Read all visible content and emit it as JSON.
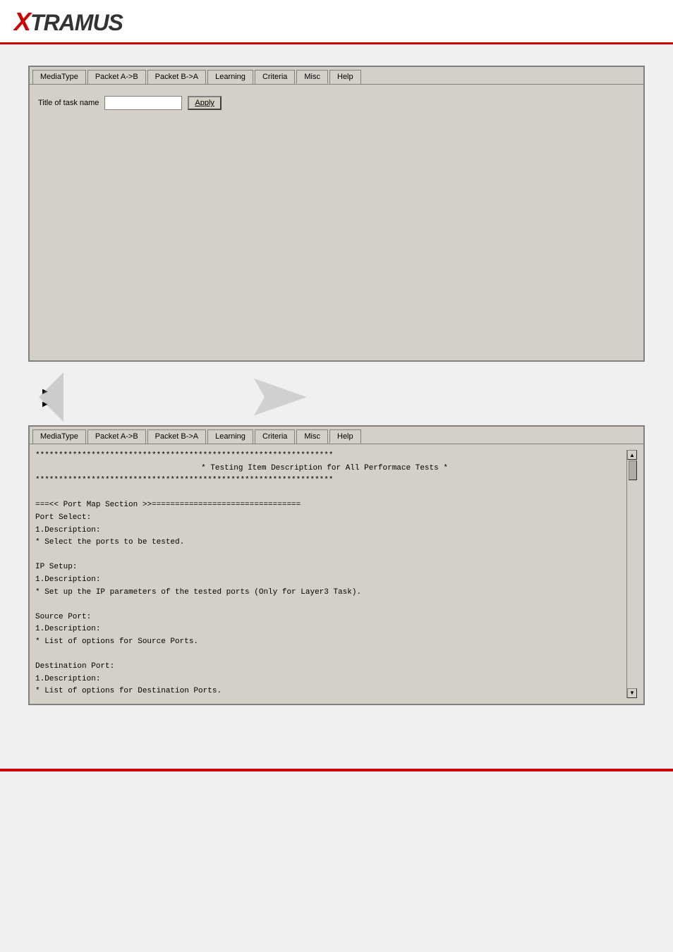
{
  "header": {
    "logo_x": "X",
    "logo_rest": "TRAMUS"
  },
  "top_panel": {
    "tabs": [
      {
        "label": "MediaType",
        "active": false
      },
      {
        "label": "Packet A->B",
        "active": false
      },
      {
        "label": "Packet B->A",
        "active": false
      },
      {
        "label": "Learning",
        "active": false
      },
      {
        "label": "Criteria",
        "active": false
      },
      {
        "label": "Misc",
        "active": true
      },
      {
        "label": "Help",
        "active": false
      }
    ],
    "task_label": "Title of task name",
    "task_input_value": "",
    "apply_button": "Apply"
  },
  "bottom_panel": {
    "tabs": [
      {
        "label": "MediaType",
        "active": false
      },
      {
        "label": "Packet A->B",
        "active": false
      },
      {
        "label": "Packet B->A",
        "active": false
      },
      {
        "label": "Learning",
        "active": false
      },
      {
        "label": "Criteria",
        "active": false
      },
      {
        "label": "Misc",
        "active": false
      },
      {
        "label": "Help",
        "active": true
      }
    ],
    "help_content": {
      "header_stars": "****************************************************************",
      "header_title": "*          Testing Item Description for All Performace Tests          *",
      "header_stars2": "****************************************************************",
      "section_port_map": "===<< Port Map Section >>================================",
      "port_select_title": "Port Select:",
      "port_select_desc": "1.Description:",
      "port_select_detail": "   * Select the ports to be tested.",
      "ip_setup_title": "IP Setup:",
      "ip_setup_desc": "1.Description:",
      "ip_setup_detail": "   * Set up the IP parameters of the tested ports (Only for Layer3 Task).",
      "source_port_title": "Source Port:",
      "source_port_desc": "1.Description:",
      "source_port_detail": "   * List of options for Source Ports.",
      "dest_port_title": "Destination Port:",
      "dest_port_desc": "1.Description:",
      "dest_port_detail": "   * List of options for Destination Ports."
    }
  },
  "footer": {
    "line_color": "#cc0000"
  }
}
